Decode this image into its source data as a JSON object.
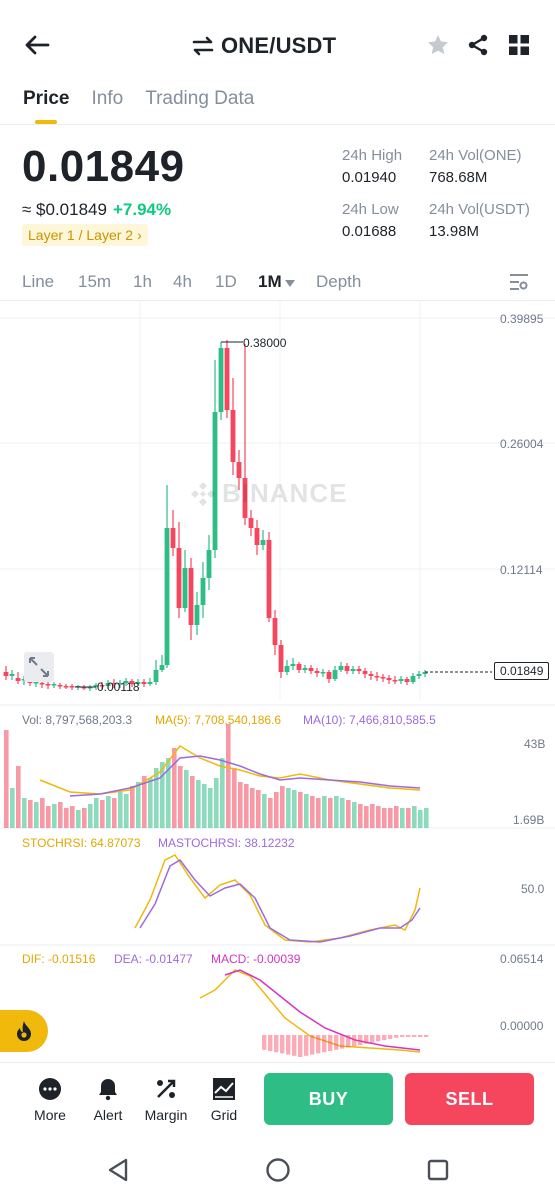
{
  "header": {
    "title": "ONE/USDT",
    "icons": [
      "back-arrow-icon",
      "swap-arrows-icon",
      "star-icon",
      "share-icon",
      "grid-icon"
    ]
  },
  "tabs": [
    {
      "label": "Price",
      "active": true
    },
    {
      "label": "Info",
      "active": false
    },
    {
      "label": "Trading Data",
      "active": false
    }
  ],
  "price": {
    "last": "0.01849",
    "approx": "≈ $0.01849",
    "change": "+7.94%",
    "tag": "Layer 1 / Layer 2",
    "tag_arrow": "›"
  },
  "stats": {
    "high_label": "24h High",
    "high_value": "0.01940",
    "low_label": "24h Low",
    "low_value": "0.01688",
    "vol_one_label": "24h Vol(ONE)",
    "vol_one_value": "768.68M",
    "vol_usdt_label": "24h Vol(USDT)",
    "vol_usdt_value": "13.98M"
  },
  "timeframes": [
    {
      "label": "Line",
      "active": false
    },
    {
      "label": "15m",
      "active": false
    },
    {
      "label": "1h",
      "active": false
    },
    {
      "label": "4h",
      "active": false
    },
    {
      "label": "1D",
      "active": false
    },
    {
      "label": "1M",
      "active": true
    },
    {
      "label": "Depth",
      "active": false
    }
  ],
  "colors": {
    "up": "#2ebd85",
    "down": "#f6465d",
    "accent": "#f0b90b",
    "ma5": "#f0b90b",
    "ma10": "#9c6ade",
    "macd": "#d633c8"
  },
  "chart_data": {
    "type": "candlestick",
    "price_axis": [
      "0.39895",
      "0.26004",
      "0.12114"
    ],
    "max_label": "0.38000",
    "min_label": "0.00118",
    "current_label": "0.01849",
    "watermark": "BINANCE",
    "volume": {
      "vol": "Vol: 8,797,568,203.3",
      "ma5": "MA(5): 7,708,540,186.6",
      "ma10": "MA(10): 7,466,810,585.5",
      "axis_top": "43B",
      "axis_bottom": "1.69B"
    },
    "stochrsi": {
      "value": "STOCHRSI: 64.87073",
      "ma": "MASTOCHRSI: 38.12232",
      "axis_mid": "50.0"
    },
    "macd": {
      "dif": "DIF: -0.01516",
      "dea": "DEA: -0.01477",
      "macd": "MACD: -0.00039",
      "axis_top": "0.06514",
      "axis_mid": "0.00000"
    }
  },
  "toolbar": {
    "more": "More",
    "alert": "Alert",
    "margin": "Margin",
    "grid": "Grid",
    "buy": "BUY",
    "sell": "SELL"
  }
}
